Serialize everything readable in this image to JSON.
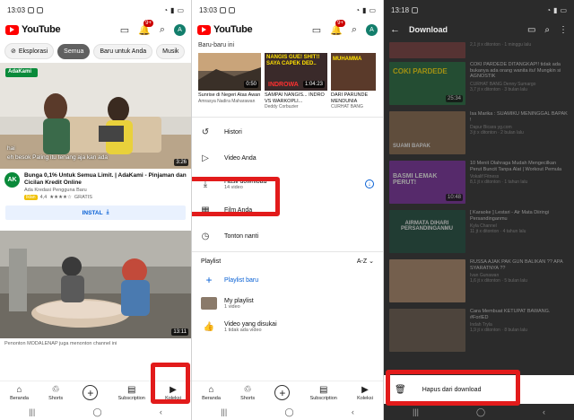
{
  "panel1": {
    "status_time": "13:03",
    "app_name": "YouTube",
    "notif_count": "9+",
    "avatar_letter": "A",
    "chips": [
      "Eksplorasi",
      "Semua",
      "Baru untuk Anda",
      "Musik"
    ],
    "ad": {
      "overlay_brand": "AdaKami",
      "subtitle_line1": "hai",
      "subtitle_line2": "eh besok Paling itu tenang aja kan ada",
      "duration": "3:26",
      "logo_text": "AK",
      "title": "Bunga 0,1% Untuk Semua Limit. | AdaKami - Pinjaman dan Cicilan Kredit Online",
      "sub": "Ada Kredasi Pengguna Baru",
      "badge": "Iklan",
      "rating": "4,4",
      "stars": "★★★★☆",
      "price": "GRATIS",
      "install_label": "INSTAL"
    },
    "video2": {
      "duration": "13:11",
      "caption": "Penonton MODALENAP juga menonton channel ini"
    },
    "nav": [
      "Beranda",
      "Shorts",
      "Subscription",
      "Koleksi"
    ]
  },
  "panel2": {
    "status_time": "13:03",
    "app_name": "YouTube",
    "notif_count": "9+",
    "avatar_letter": "A",
    "recent_title": "Baru-baru ini",
    "recent": [
      {
        "title": "Sunrise di Negeri Atas Awan",
        "channel": "Amrasya Nadira Maharawan",
        "duration": "0:50"
      },
      {
        "title": "NANGIS GUE! SHIT!! SAYA CAPEK DED..",
        "overlay": "INDROWA",
        "title2": "SAMPAI NANGIS... INDRO VS WARKOPLI...",
        "channel": "Deddy Corbuzier",
        "duration": "1:04:23"
      },
      {
        "title": "DARI PARUNDE MENDUNIA",
        "channel": "CURHAT BANG",
        "overlay": "MUHAMMA",
        "duration": ""
      }
    ],
    "menu": [
      {
        "label": "Histori",
        "sub": ""
      },
      {
        "label": "Video Anda",
        "sub": ""
      },
      {
        "label": "Hasil download",
        "sub": "14 video"
      },
      {
        "label": "Film Anda",
        "sub": ""
      },
      {
        "label": "Tonton nanti",
        "sub": ""
      }
    ],
    "playlist_title": "Playlist",
    "sort_label": "A-Z",
    "new_playlist": "Playlist baru",
    "playlists": [
      {
        "label": "My playlist",
        "sub": "1 video"
      },
      {
        "label": "Video yang disukai",
        "sub": "1 tidak ada video"
      }
    ],
    "nav": [
      "Beranda",
      "Shorts",
      "Subscription",
      "Koleksi"
    ]
  },
  "panel3": {
    "status_time": "13:18",
    "title": "Download",
    "items": [
      {
        "title": "",
        "channel": "",
        "stats": "2,1 jt x ditonton · 1 minggu lalu",
        "duration": "",
        "thumb_text": ""
      },
      {
        "title": "COKI PARDEDE DITANGKAP!! tidak ada bukanya ada orang wanita itu! Mungkin si AGNOSTIK",
        "channel": "CURHAT BANG Denny Sumargo",
        "stats": "3,7 jt x ditonton · 3 bulan lalu",
        "duration": "25:34",
        "thumb_text": "COKI PARDEDE"
      },
      {
        "title": "Isa Marika : SUAMIKU MENINGGAL BAPAK !",
        "channel": "Dapur Bicara yg.com",
        "stats": "3 jt x ditonton · 2 bulan lalu",
        "duration": "",
        "thumb_text": "SUAMI BAPAK"
      },
      {
        "title": "10 Menit Olahraga Mudah Mengecilkan Perut Buncit Tanpa Alat | Workout Pemula",
        "channel": "Vokalif Fitness",
        "stats": "8,1 jt x ditonton · 1 tahun lalu",
        "duration": "10:48",
        "thumb_text": "BASMI LEMAK PERUT!"
      },
      {
        "title": "[ Karaoke ] Lestari - Air Mata Diiringi Persandinganmu",
        "channel": "Kyla Channel",
        "stats": "11 jt x ditonton · 4 tahun lalu",
        "duration": "",
        "thumb_text": "AIRMATA DIHARI PERSANDINGANMU"
      },
      {
        "title": "RUSSA AJAK PAK GUN BALIKAN ?? APA SYARATNYA ??",
        "channel": "Ivan Gunawan",
        "stats": "1,6 jt x ditonton · 5 bulan lalu",
        "duration": "",
        "thumb_text": ""
      },
      {
        "title": "Cara Membuat KETUPAT BAWANG. #ForIED",
        "channel": "Indah Tryla",
        "stats": "1,9 jt x ditonton · 8 bulan lalu",
        "duration": "",
        "thumb_text": ""
      }
    ],
    "sheet_label": "Hapus dari download"
  }
}
